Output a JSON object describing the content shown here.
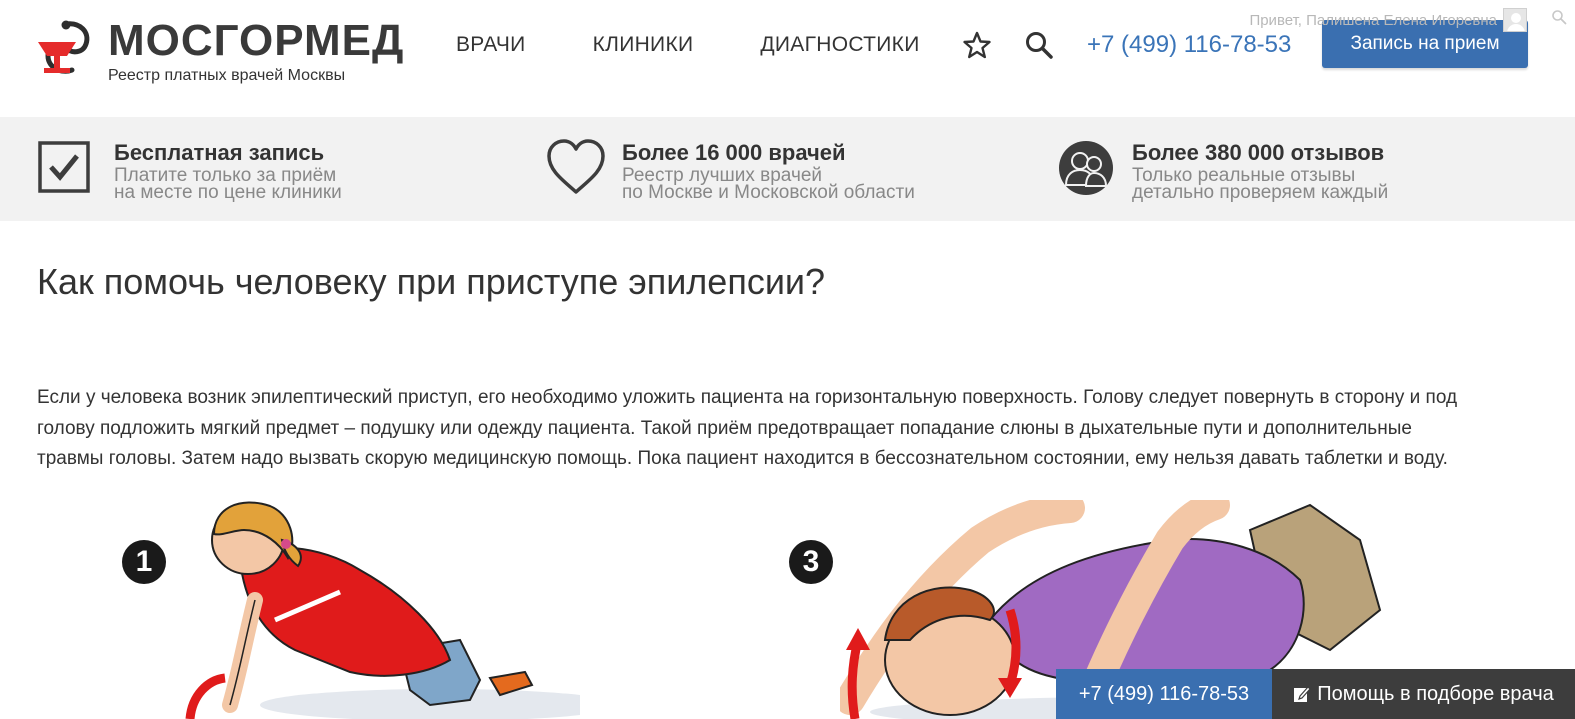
{
  "header": {
    "logo_title": "МОСГОРМЕД",
    "logo_subtitle": "Реестр платных врачей Москвы",
    "nav": [
      "ВРАЧИ",
      "КЛИНИКИ",
      "ДИАГНОСТИКИ"
    ],
    "phone": "+7 (499) 116-78-53",
    "cta_label": "Запись на прием",
    "greeting": "Привет, Палишена Елена Игоревна"
  },
  "features": [
    {
      "icon": "checkbox-icon",
      "title": "Бесплатная запись",
      "line1": "Платите только за приём",
      "line2": "на месте по цене клиники"
    },
    {
      "icon": "heart-icon",
      "title": "Более 16 000 врачей",
      "line1": "Реестр лучших врачей",
      "line2": "по Москве и Московской области"
    },
    {
      "icon": "people-icon",
      "title": "Более 380 000 отзывов",
      "line1": "Только реальные отзывы",
      "line2": "детально проверяем каждый"
    }
  ],
  "article": {
    "title": "Как помочь человеку при приступе эпилепсии?",
    "paragraph_lines": [
      "Если у человека возник эпилептический приступ, его необходимо уложить пациента на горизонтальную поверхность. Голову следует повернуть в сторону и под",
      "голову подложить мягкий предмет – подушку или одежду пациента. Такой приём предотвращает попадание слюны в дыхательные пути и дополнительные",
      "травмы головы. Затем надо вызвать скорую медицинскую помощь. Пока пациент находится в бессознательном состоянии, ему нельзя давать таблетки и воду."
    ],
    "steps": [
      "1",
      "3"
    ]
  },
  "bottom_bar": {
    "phone": "+7 (499) 116-78-53",
    "help_label": "Помощь в подборе врача"
  },
  "colors": {
    "accent": "#3a6fb0",
    "phone_text": "#3a74b8",
    "band": "#f2f2f2",
    "dark_bar": "#3d3d3d",
    "logo_red": "#e52b2b"
  }
}
